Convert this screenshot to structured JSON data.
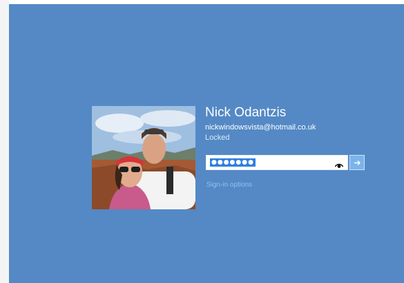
{
  "user": {
    "name": "Nick Odantzis",
    "email": "nickwindowsvista@hotmail.co.uk",
    "status": "Locked"
  },
  "password": {
    "value": "●●●●●●●"
  },
  "links": {
    "signin_options": "Sign-in options"
  },
  "icons": {
    "reveal": "eye-icon",
    "submit": "arrow-right-icon"
  },
  "colors": {
    "background": "#5489c5",
    "password_highlight": "#2f7fe0",
    "submit_button": "#7ab4ea",
    "link": "#8cc4f3"
  }
}
